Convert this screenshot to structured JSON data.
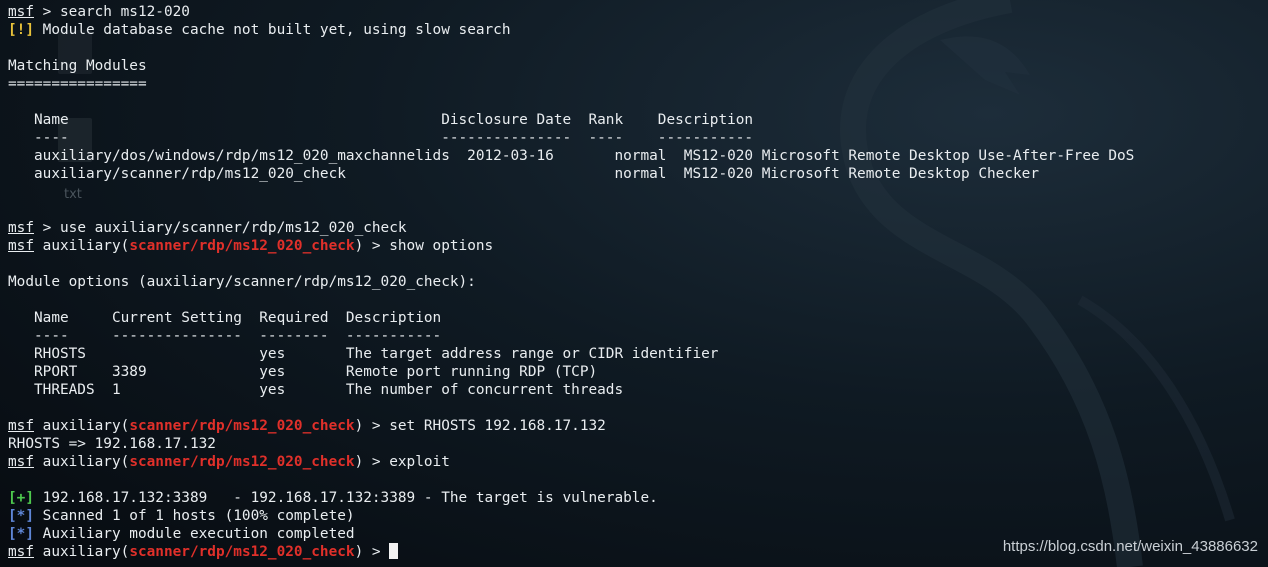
{
  "background": {
    "desktop_icon_label": "txt"
  },
  "watermark": "https://blog.csdn.net/weixin_43886632",
  "prompt": {
    "name": "msf",
    "gt": ">"
  },
  "module_path": "scanner/rdp/ms12_020_check",
  "colors": {
    "accent_red": "#e0302a",
    "warn_yellow": "#e8c23a",
    "success_green": "#4ec94e",
    "info_blue": "#5f86d6"
  },
  "lines": {
    "l01": {
      "cmd": " > search ms12-020"
    },
    "l02": {
      "tag": "[!]",
      "text": " Module database cache not built yet, using slow search"
    },
    "l04": "Matching Modules",
    "l05": "================",
    "l07": "   Name                                           Disclosure Date  Rank    Description",
    "l08": "   ----                                           ---------------  ----    -----------",
    "l09": "   auxiliary/dos/windows/rdp/ms12_020_maxchannelids  2012-03-16       normal  MS12-020 Microsoft Remote Desktop Use-After-Free DoS",
    "l10": "   auxiliary/scanner/rdp/ms12_020_check                               normal  MS12-020 Microsoft Remote Desktop Checker",
    "l13": {
      "cmd": " > use auxiliary/scanner/rdp/ms12_020_check"
    },
    "l14": {
      "pre": " auxiliary(",
      "post": ") > show options"
    },
    "l16": "Module options (auxiliary/scanner/rdp/ms12_020_check):",
    "l18": "   Name     Current Setting  Required  Description",
    "l19": "   ----     ---------------  --------  -----------",
    "l20": "   RHOSTS                    yes       The target address range or CIDR identifier",
    "l21": "   RPORT    3389             yes       Remote port running RDP (TCP)",
    "l22": "   THREADS  1                yes       The number of concurrent threads",
    "l24": {
      "pre": " auxiliary(",
      "post": ") > set RHOSTS 192.168.17.132"
    },
    "l25": "RHOSTS => 192.168.17.132",
    "l26": {
      "pre": " auxiliary(",
      "post": ") > exploit"
    },
    "l28": {
      "tag": "[+]",
      "text": " 192.168.17.132:3389   - 192.168.17.132:3389 - The target is vulnerable."
    },
    "l29": {
      "tag": "[*]",
      "text": " Scanned 1 of 1 hosts (100% complete)"
    },
    "l30": {
      "tag": "[*]",
      "text": " Auxiliary module execution completed"
    },
    "l31": {
      "pre": " auxiliary(",
      "post": ") > "
    }
  }
}
